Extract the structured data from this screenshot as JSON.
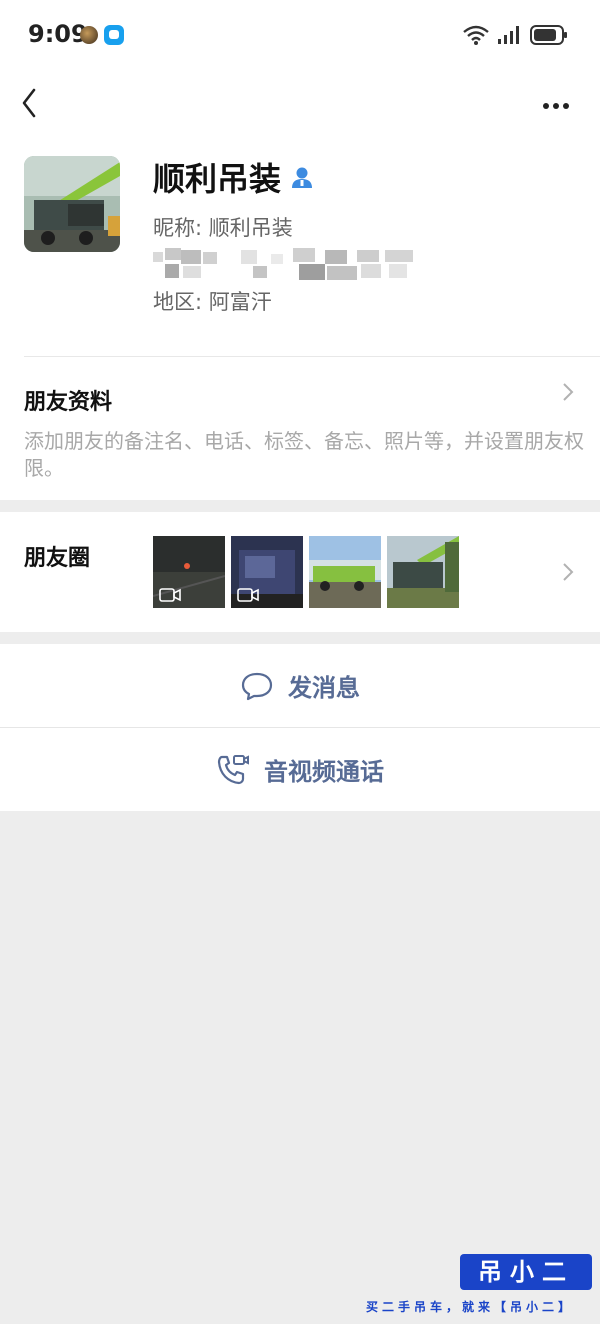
{
  "status_bar": {
    "time": "9:09"
  },
  "profile": {
    "name": "顺利吊装",
    "nickname": "昵称: 顺利吊装",
    "region": "地区: 阿富汗"
  },
  "friend_info": {
    "title": "朋友资料",
    "description": "添加朋友的备注名、电话、标签、备忘、照片等，并设置朋友权限。"
  },
  "moments": {
    "title": "朋友圈"
  },
  "actions": {
    "message": "发消息",
    "call": "音视频通话"
  },
  "watermark": {
    "brand": "吊小二",
    "slogan": "买二手吊车，就来【吊小二】"
  },
  "colors": {
    "link": "#576b95",
    "verify_icon": "#3d8be0",
    "watermark": "#1a44c8"
  }
}
